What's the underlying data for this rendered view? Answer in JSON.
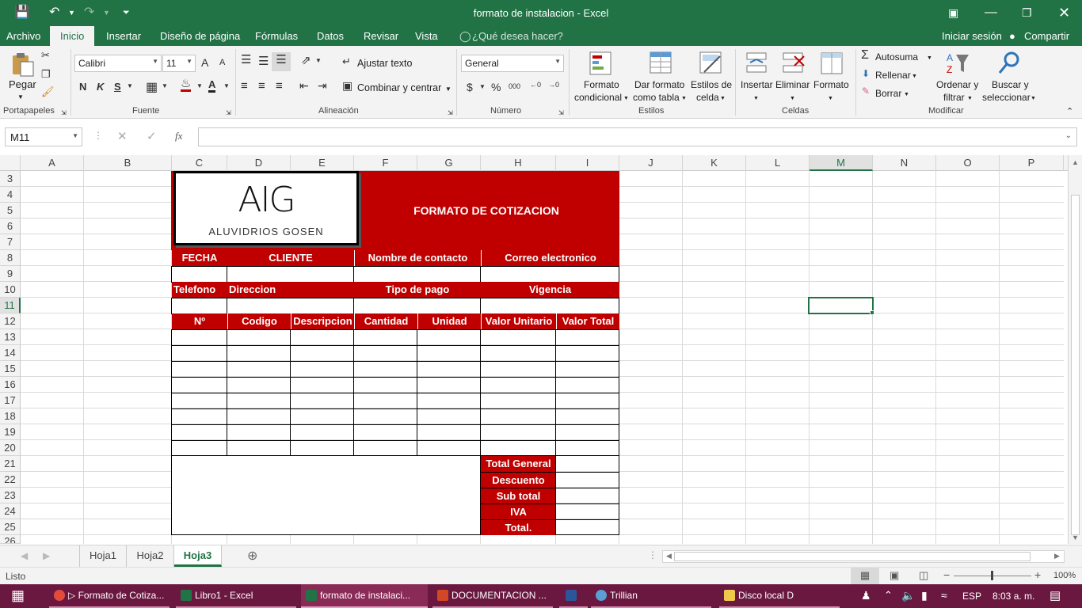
{
  "app": {
    "window_title": "formato de instalacion - Excel",
    "accent": "#217346"
  },
  "menu": {
    "items": [
      "Archivo",
      "Inicio",
      "Insertar",
      "Diseño de página",
      "Fórmulas",
      "Datos",
      "Revisar",
      "Vista"
    ],
    "tell_me": "¿Qué desea hacer?",
    "signin": "Iniciar sesión",
    "share": "Compartir"
  },
  "ribbon": {
    "clipboard": {
      "paste": "Pegar",
      "label": "Portapapeles"
    },
    "font": {
      "name": "Calibri",
      "size": "11",
      "label": "Fuente",
      "bold": "N",
      "italic": "K",
      "underline": "S",
      "grow": "A",
      "shrink": "A",
      "color_letter": "A"
    },
    "alignment": {
      "wrap": "Ajustar texto",
      "merge": "Combinar y centrar",
      "label": "Alineación"
    },
    "number": {
      "format": "General",
      "currency": "$",
      "percent": "%",
      "thousands": "000",
      "inc": ",0→,00",
      "dec": ",00→,0",
      "label": "Número"
    },
    "styles": {
      "conditional_1": "Formato",
      "conditional_2": "condicional",
      "table_1": "Dar formato",
      "table_2": "como tabla",
      "cell_1": "Estilos de",
      "cell_2": "celda",
      "label": "Estilos"
    },
    "cells": {
      "insert": "Insertar",
      "delete": "Eliminar",
      "format": "Formato",
      "label": "Celdas"
    },
    "editing": {
      "autosum": "Autosuma",
      "fill": "Rellenar",
      "clear": "Borrar",
      "sort_1": "Ordenar y",
      "sort_2": "filtrar",
      "find_1": "Buscar y",
      "find_2": "seleccionar",
      "label": "Modificar"
    }
  },
  "formula_bar": {
    "name_box": "M11",
    "fx": "fx",
    "formula": ""
  },
  "columns": [
    "A",
    "B",
    "C",
    "D",
    "E",
    "F",
    "G",
    "H",
    "I",
    "J",
    "K",
    "L",
    "M",
    "N",
    "O",
    "P"
  ],
  "rows": [
    "3",
    "4",
    "5",
    "6",
    "7",
    "8",
    "9",
    "10",
    "11",
    "12",
    "13",
    "14",
    "15",
    "16",
    "17",
    "18",
    "19",
    "20",
    "21",
    "22",
    "23",
    "24",
    "25",
    "26"
  ],
  "selected": {
    "column": "M",
    "row": "11"
  },
  "sheet": {
    "logo_text": "AIG",
    "logo_sub": "ALUVIDRIOS GOSEN",
    "title": "FORMATO DE COTIZACION",
    "row8": [
      "FECHA",
      "CLIENTE",
      "Nombre de contacto",
      "Correo electronico"
    ],
    "row10": [
      "Telefono",
      "Direccion",
      "Tipo de pago",
      "Vigencia"
    ],
    "row12": [
      "Nº",
      "Codigo",
      "Descripcion",
      "Cantidad",
      "Unidad",
      "Valor Unitario",
      "Valor Total"
    ],
    "totals": [
      "Total General",
      "Descuento",
      "Sub total",
      "IVA",
      "Total."
    ],
    "fill_color": "#c00000"
  },
  "sheets": [
    "Hoja1",
    "Hoja2",
    "Hoja3"
  ],
  "active_sheet": "Hoja3",
  "status": {
    "ready": "Listo",
    "zoom": "100%"
  },
  "taskbar": {
    "items": [
      "▷ Formato de Cotiza...",
      "Libro1 - Excel",
      "formato de instalaci...",
      "DOCUMENTACION ...",
      "",
      "Trillian",
      "Disco local D"
    ],
    "lang": "ESP",
    "time": "8:03 a. m."
  }
}
